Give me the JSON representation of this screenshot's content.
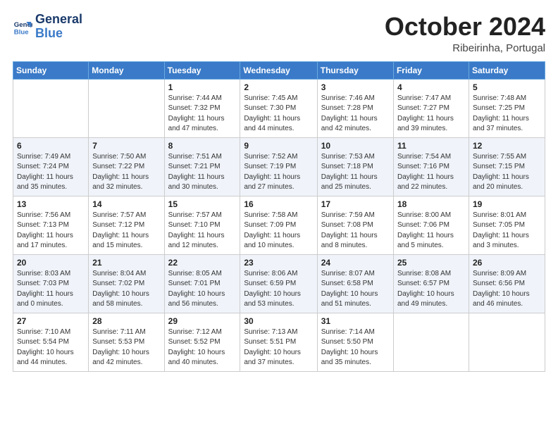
{
  "header": {
    "logo_line1": "General",
    "logo_line2": "Blue",
    "month": "October 2024",
    "location": "Ribeirinha, Portugal"
  },
  "days_of_week": [
    "Sunday",
    "Monday",
    "Tuesday",
    "Wednesday",
    "Thursday",
    "Friday",
    "Saturday"
  ],
  "weeks": [
    [
      {
        "day": "",
        "detail": ""
      },
      {
        "day": "",
        "detail": ""
      },
      {
        "day": "1",
        "detail": "Sunrise: 7:44 AM\nSunset: 7:32 PM\nDaylight: 11 hours and 47 minutes."
      },
      {
        "day": "2",
        "detail": "Sunrise: 7:45 AM\nSunset: 7:30 PM\nDaylight: 11 hours and 44 minutes."
      },
      {
        "day": "3",
        "detail": "Sunrise: 7:46 AM\nSunset: 7:28 PM\nDaylight: 11 hours and 42 minutes."
      },
      {
        "day": "4",
        "detail": "Sunrise: 7:47 AM\nSunset: 7:27 PM\nDaylight: 11 hours and 39 minutes."
      },
      {
        "day": "5",
        "detail": "Sunrise: 7:48 AM\nSunset: 7:25 PM\nDaylight: 11 hours and 37 minutes."
      }
    ],
    [
      {
        "day": "6",
        "detail": "Sunrise: 7:49 AM\nSunset: 7:24 PM\nDaylight: 11 hours and 35 minutes."
      },
      {
        "day": "7",
        "detail": "Sunrise: 7:50 AM\nSunset: 7:22 PM\nDaylight: 11 hours and 32 minutes."
      },
      {
        "day": "8",
        "detail": "Sunrise: 7:51 AM\nSunset: 7:21 PM\nDaylight: 11 hours and 30 minutes."
      },
      {
        "day": "9",
        "detail": "Sunrise: 7:52 AM\nSunset: 7:19 PM\nDaylight: 11 hours and 27 minutes."
      },
      {
        "day": "10",
        "detail": "Sunrise: 7:53 AM\nSunset: 7:18 PM\nDaylight: 11 hours and 25 minutes."
      },
      {
        "day": "11",
        "detail": "Sunrise: 7:54 AM\nSunset: 7:16 PM\nDaylight: 11 hours and 22 minutes."
      },
      {
        "day": "12",
        "detail": "Sunrise: 7:55 AM\nSunset: 7:15 PM\nDaylight: 11 hours and 20 minutes."
      }
    ],
    [
      {
        "day": "13",
        "detail": "Sunrise: 7:56 AM\nSunset: 7:13 PM\nDaylight: 11 hours and 17 minutes."
      },
      {
        "day": "14",
        "detail": "Sunrise: 7:57 AM\nSunset: 7:12 PM\nDaylight: 11 hours and 15 minutes."
      },
      {
        "day": "15",
        "detail": "Sunrise: 7:57 AM\nSunset: 7:10 PM\nDaylight: 11 hours and 12 minutes."
      },
      {
        "day": "16",
        "detail": "Sunrise: 7:58 AM\nSunset: 7:09 PM\nDaylight: 11 hours and 10 minutes."
      },
      {
        "day": "17",
        "detail": "Sunrise: 7:59 AM\nSunset: 7:08 PM\nDaylight: 11 hours and 8 minutes."
      },
      {
        "day": "18",
        "detail": "Sunrise: 8:00 AM\nSunset: 7:06 PM\nDaylight: 11 hours and 5 minutes."
      },
      {
        "day": "19",
        "detail": "Sunrise: 8:01 AM\nSunset: 7:05 PM\nDaylight: 11 hours and 3 minutes."
      }
    ],
    [
      {
        "day": "20",
        "detail": "Sunrise: 8:03 AM\nSunset: 7:03 PM\nDaylight: 11 hours and 0 minutes."
      },
      {
        "day": "21",
        "detail": "Sunrise: 8:04 AM\nSunset: 7:02 PM\nDaylight: 10 hours and 58 minutes."
      },
      {
        "day": "22",
        "detail": "Sunrise: 8:05 AM\nSunset: 7:01 PM\nDaylight: 10 hours and 56 minutes."
      },
      {
        "day": "23",
        "detail": "Sunrise: 8:06 AM\nSunset: 6:59 PM\nDaylight: 10 hours and 53 minutes."
      },
      {
        "day": "24",
        "detail": "Sunrise: 8:07 AM\nSunset: 6:58 PM\nDaylight: 10 hours and 51 minutes."
      },
      {
        "day": "25",
        "detail": "Sunrise: 8:08 AM\nSunset: 6:57 PM\nDaylight: 10 hours and 49 minutes."
      },
      {
        "day": "26",
        "detail": "Sunrise: 8:09 AM\nSunset: 6:56 PM\nDaylight: 10 hours and 46 minutes."
      }
    ],
    [
      {
        "day": "27",
        "detail": "Sunrise: 7:10 AM\nSunset: 5:54 PM\nDaylight: 10 hours and 44 minutes."
      },
      {
        "day": "28",
        "detail": "Sunrise: 7:11 AM\nSunset: 5:53 PM\nDaylight: 10 hours and 42 minutes."
      },
      {
        "day": "29",
        "detail": "Sunrise: 7:12 AM\nSunset: 5:52 PM\nDaylight: 10 hours and 40 minutes."
      },
      {
        "day": "30",
        "detail": "Sunrise: 7:13 AM\nSunset: 5:51 PM\nDaylight: 10 hours and 37 minutes."
      },
      {
        "day": "31",
        "detail": "Sunrise: 7:14 AM\nSunset: 5:50 PM\nDaylight: 10 hours and 35 minutes."
      },
      {
        "day": "",
        "detail": ""
      },
      {
        "day": "",
        "detail": ""
      }
    ]
  ]
}
